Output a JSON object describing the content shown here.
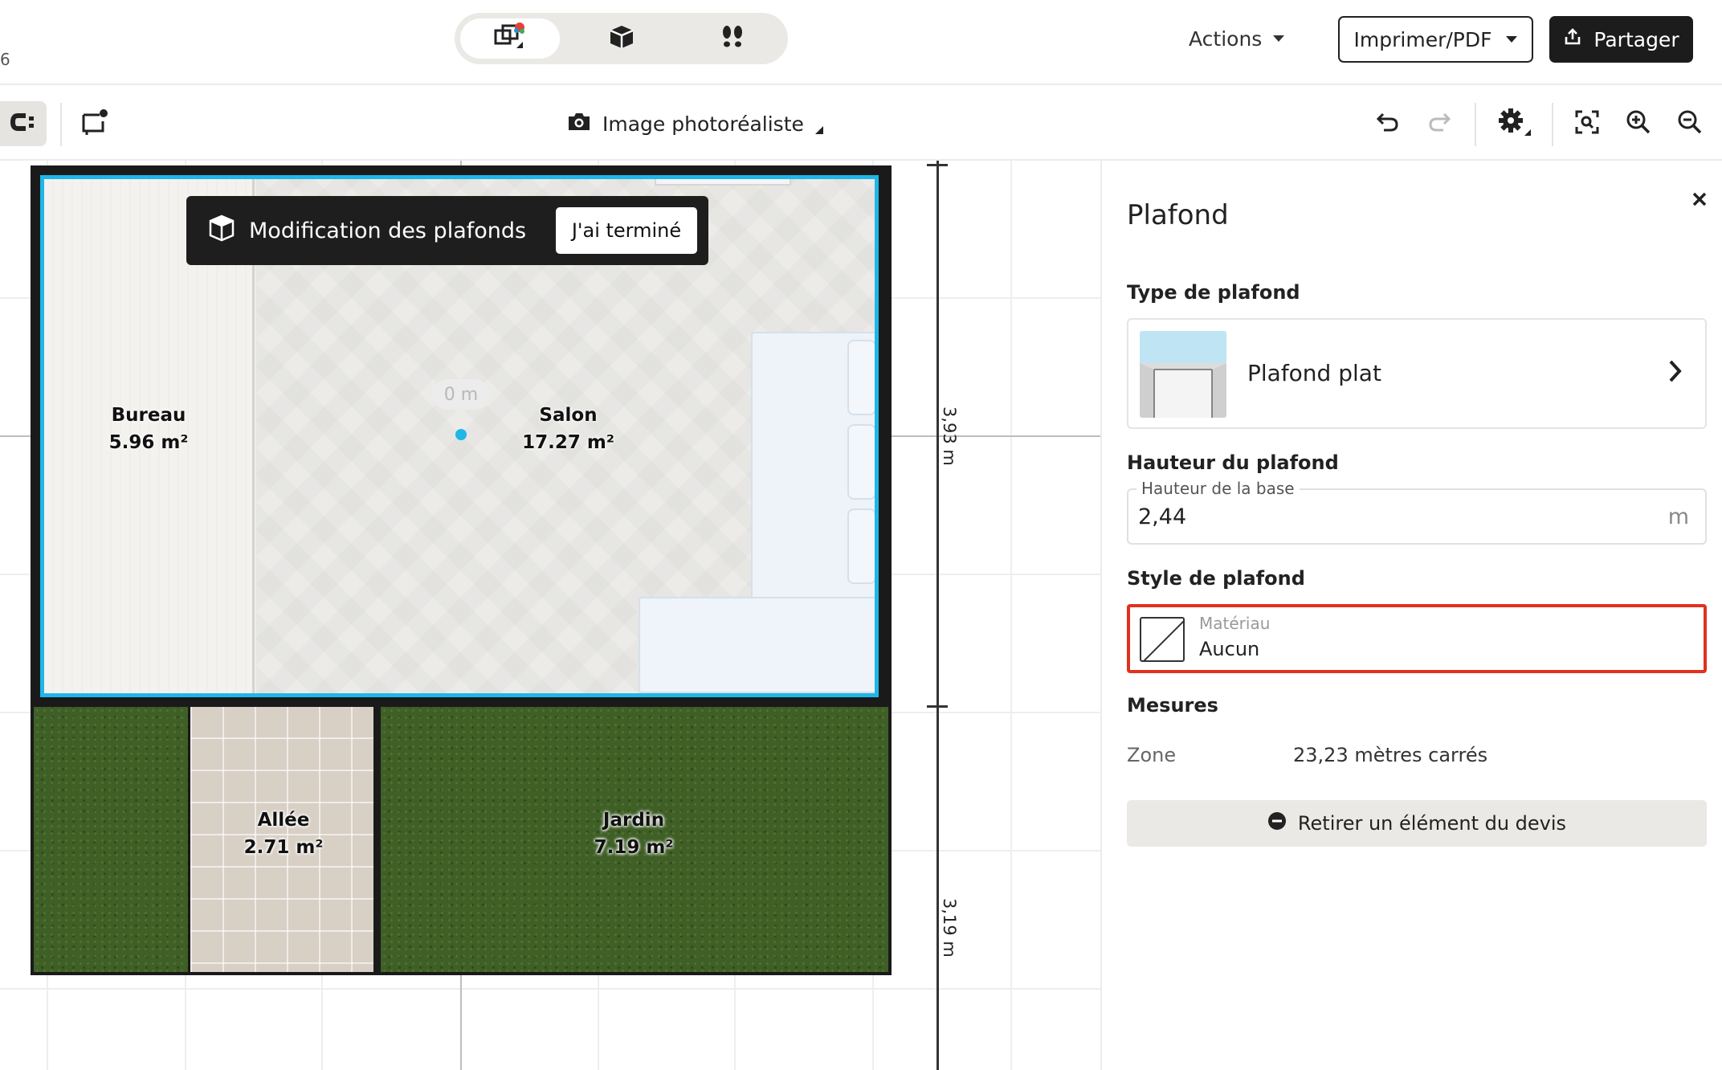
{
  "topbar": {
    "edge_digit": "6",
    "view_modes": [
      {
        "name": "2d-plan",
        "active": true
      },
      {
        "name": "3d-box",
        "active": false
      },
      {
        "name": "walkthrough",
        "active": false
      }
    ],
    "actions_label": "Actions",
    "print_label": "Imprimer/PDF",
    "share_label": "Partager"
  },
  "toolbar": {
    "photo_label": "Image photoréaliste"
  },
  "canvas": {
    "banner_text": "Modification des plafonds",
    "banner_done": "J'ai terminé",
    "zero_label": "0 m",
    "rooms": [
      {
        "name": "Bureau",
        "area": "5.96 m²"
      },
      {
        "name": "Salon",
        "area": "17.27 m²"
      },
      {
        "name": "Allée",
        "area": "2.71 m²"
      },
      {
        "name": "Jardin",
        "area": "7.19 m²"
      }
    ],
    "dimensions": [
      "3,93 m",
      "3,19 m"
    ]
  },
  "panel": {
    "title": "Plafond",
    "type_section": "Type de plafond",
    "type_name": "Plafond plat",
    "height_section": "Hauteur du plafond",
    "height_legend": "Hauteur de la base",
    "height_value": "2,44",
    "height_unit": "m",
    "style_section": "Style de plafond",
    "material_label": "Matériau",
    "material_value": "Aucun",
    "measures_section": "Mesures",
    "measure_key": "Zone",
    "measure_value": "23,23 mètres carrés",
    "remove_label": "Retirer un élément du devis"
  },
  "colors": {
    "selection_blue": "#1fb6e8",
    "highlight_red": "#e0311f",
    "grass": "#3f5f27"
  }
}
